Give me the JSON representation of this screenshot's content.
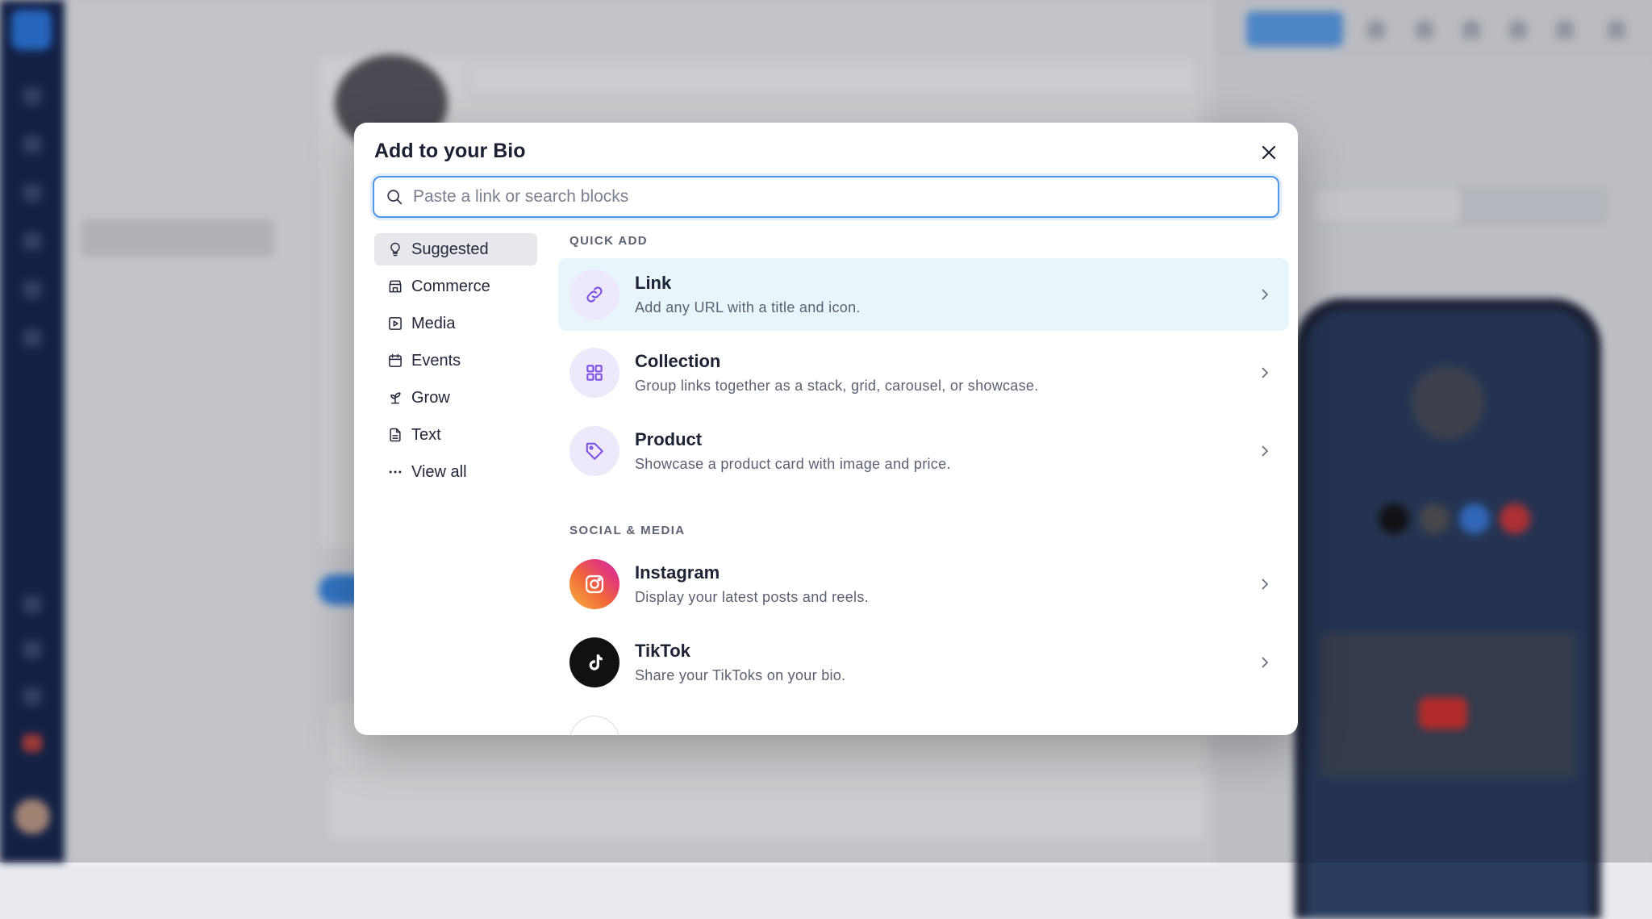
{
  "modal": {
    "title": "Add to your Bio",
    "search_placeholder": "Paste a link or search blocks",
    "categories": [
      {
        "label": "Suggested",
        "icon": "lightbulb-icon",
        "active": true
      },
      {
        "label": "Commerce",
        "icon": "store-icon"
      },
      {
        "label": "Media",
        "icon": "play-square-icon"
      },
      {
        "label": "Events",
        "icon": "calendar-icon"
      },
      {
        "label": "Grow",
        "icon": "sprout-icon"
      },
      {
        "label": "Text",
        "icon": "file-text-icon"
      },
      {
        "label": "View all",
        "icon": "more-horizontal-icon"
      }
    ],
    "quick_add": {
      "heading": "QUICK ADD",
      "items": [
        {
          "name": "Link",
          "desc": "Add any URL with a title and icon.",
          "icon": "link-icon",
          "highlighted": true
        },
        {
          "name": "Collection",
          "desc": "Group links together as a stack, grid, carousel, or showcase.",
          "icon": "grid-icon"
        },
        {
          "name": "Product",
          "desc": "Showcase a product card with image and price.",
          "icon": "tag-icon"
        }
      ]
    },
    "social_media": {
      "heading": "SOCIAL & MEDIA",
      "items": [
        {
          "name": "Instagram",
          "desc": "Display your latest posts and reels.",
          "icon": "instagram-icon"
        },
        {
          "name": "TikTok",
          "desc": "Share your TikToks on your bio.",
          "icon": "tiktok-icon"
        }
      ]
    }
  },
  "colors": {
    "accent": "#4f95e6",
    "highlight_row": "#e8f6fc",
    "icon_bg_purple": "#ede9fb",
    "icon_purple": "#7c4fe0",
    "tiktok_bg": "#111111"
  }
}
